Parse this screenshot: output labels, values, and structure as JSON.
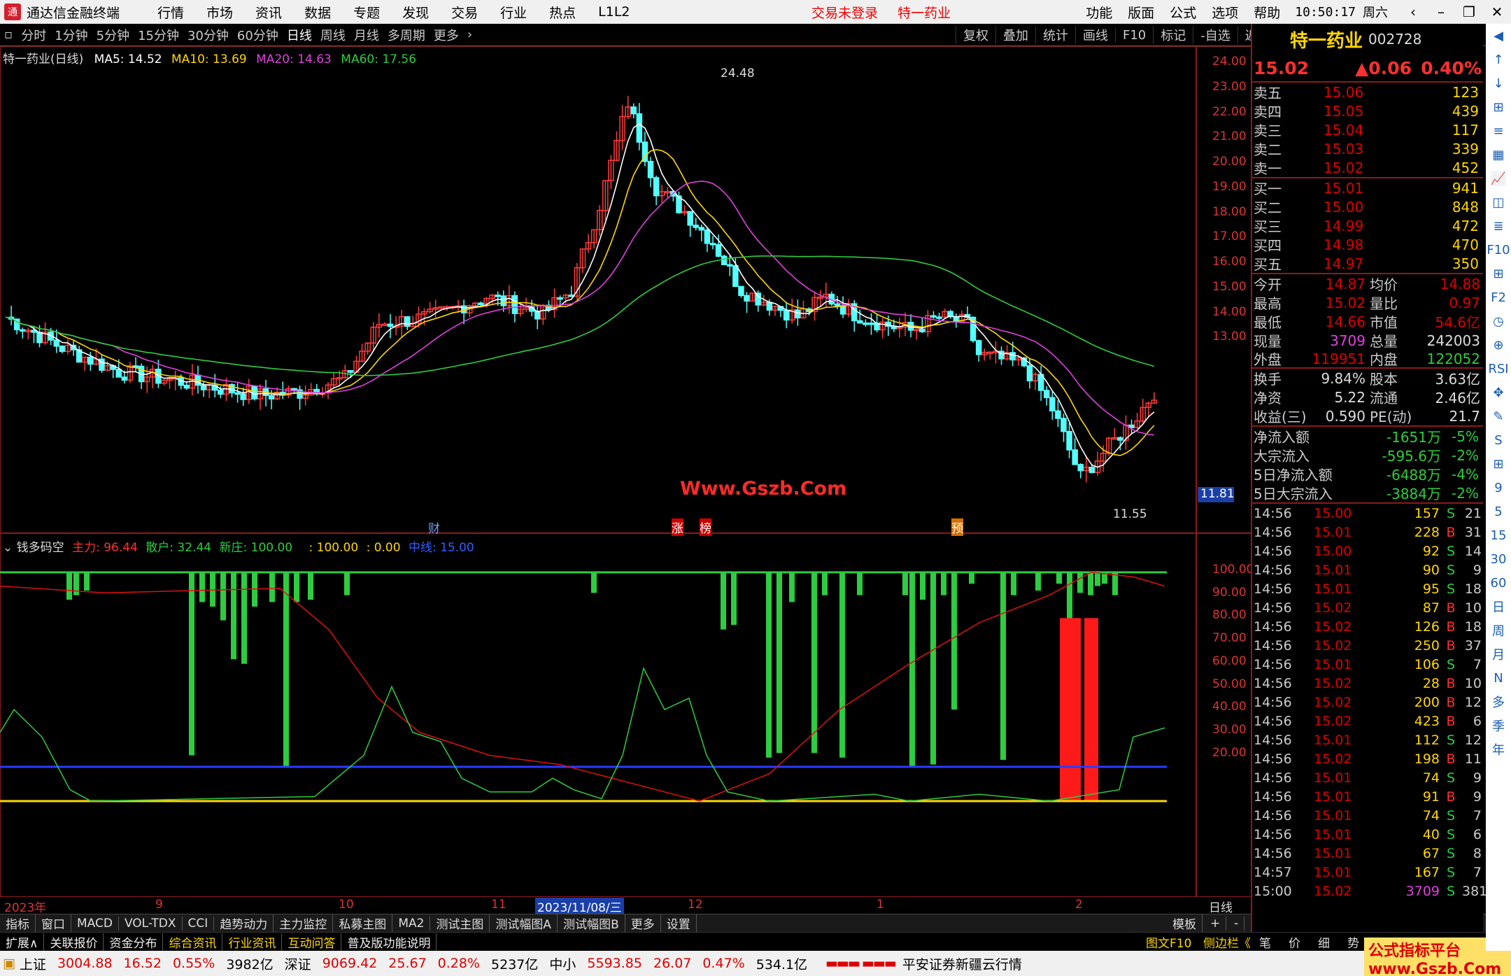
{
  "app": {
    "name": "通达信金融终端",
    "menu": [
      "行情",
      "市场",
      "资讯",
      "数据",
      "专题",
      "发现",
      "交易",
      "行业",
      "热点",
      "L1L2"
    ],
    "center": [
      "交易未登录",
      "特一药业"
    ],
    "right_menu": [
      "功能",
      "版面",
      "公式",
      "选项",
      "帮助"
    ],
    "clock": "10:50:17",
    "weekday": "周六"
  },
  "toolbar": {
    "tabs": [
      "分时",
      "1分钟",
      "5分钟",
      "15分钟",
      "30分钟",
      "60分钟",
      "日线",
      "周线",
      "月线",
      "多周期",
      "更多"
    ],
    "active_tab": "日线",
    "right": [
      "复权",
      "叠加",
      "统计",
      "画线",
      "F10",
      "标记",
      "-自选",
      "返回"
    ]
  },
  "chart_header": {
    "title": "特一药业(日线)",
    "ma5": "MA5: 14.52",
    "ma10": "MA10: 13.69",
    "ma20": "MA20: 14.63",
    "ma60": "MA60: 17.56"
  },
  "price_axis": [
    "24.00",
    "23.00",
    "22.00",
    "21.00",
    "20.00",
    "19.00",
    "18.00",
    "17.00",
    "16.00",
    "15.00",
    "14.00",
    "13.00"
  ],
  "current_price_tag": "11.81",
  "high_label": "24.48",
  "low_label": "11.55",
  "markers": [
    "财",
    "涨",
    "榜",
    "预"
  ],
  "indicator": {
    "name": "钱多码空",
    "zl": "主力: 96.44",
    "sh": "散户: 32.44",
    "xz": "新庄: 100.00",
    "v1": ": 100.00",
    "v2": ": 0.00",
    "zx": "中线: 15.00"
  },
  "ind_axis": [
    "100.00",
    "90.00",
    "80.00",
    "70.00",
    "60.00",
    "50.00",
    "40.00",
    "30.00",
    "20.00"
  ],
  "time_axis": [
    "2023年",
    "9",
    "10",
    "11",
    "2023/11/08/三",
    "12",
    "1",
    "2"
  ],
  "period_label": "日线",
  "watermark": "Www.Gszb.Com",
  "bottom_tabs": [
    "指标",
    "窗口",
    "MACD",
    "VOL-TDX",
    "CCI",
    "趋势动力",
    "主力监控",
    "私募主图",
    "MA2",
    "测试主图",
    "测试幅图A",
    "测试幅图B",
    "更多",
    "设置"
  ],
  "bottom_right": [
    "模板",
    "+",
    "-"
  ],
  "ext_tabs": [
    "扩展∧",
    "关联报价",
    "资金分布",
    "综合资讯",
    "行业资讯",
    "互动问答",
    "普及版功能说明"
  ],
  "ext_right": [
    "图文F10",
    "侧边栏《",
    "笔",
    "价",
    "细",
    "势"
  ],
  "stock": {
    "name": "特一药业",
    "code": "002728",
    "price": "15.02",
    "change": "▲0.06",
    "pct": "0.40%"
  },
  "asks": [
    [
      "卖五",
      "15.06",
      "123"
    ],
    [
      "卖四",
      "15.05",
      "439"
    ],
    [
      "卖三",
      "15.04",
      "117"
    ],
    [
      "卖二",
      "15.03",
      "339"
    ],
    [
      "卖一",
      "15.02",
      "452"
    ]
  ],
  "bids": [
    [
      "买一",
      "15.01",
      "941"
    ],
    [
      "买二",
      "15.00",
      "848"
    ],
    [
      "买三",
      "14.99",
      "472"
    ],
    [
      "买四",
      "14.98",
      "470"
    ],
    [
      "买五",
      "14.97",
      "350"
    ]
  ],
  "stats": [
    [
      "今开",
      "14.87",
      "均价",
      "14.88"
    ],
    [
      "最高",
      "15.02",
      "量比",
      "0.97"
    ],
    [
      "最低",
      "14.66",
      "市值",
      "54.6亿"
    ],
    [
      "现量",
      "3709",
      "总量",
      "242003"
    ],
    [
      "外盘",
      "119951",
      "内盘",
      "122052"
    ],
    [
      "换手",
      "9.84%",
      "股本",
      "3.63亿"
    ],
    [
      "净资",
      "5.22",
      "流通",
      "2.46亿"
    ],
    [
      "收益(三)",
      "0.590",
      "PE(动)",
      "21.7"
    ]
  ],
  "flows": [
    [
      "净流入额",
      "-1651万",
      "-5%"
    ],
    [
      "大宗流入",
      "-595.6万",
      "-2%"
    ],
    [
      "5日净流入额",
      "-6488万",
      "-4%"
    ],
    [
      "5日大宗流入",
      "-3884万",
      "-2%"
    ]
  ],
  "ticks": [
    [
      "14:56",
      "15.00",
      "157",
      "S",
      "21"
    ],
    [
      "14:56",
      "15.01",
      "228",
      "B",
      "31"
    ],
    [
      "14:56",
      "15.00",
      "92",
      "S",
      "14"
    ],
    [
      "14:56",
      "15.01",
      "90",
      "S",
      "9"
    ],
    [
      "14:56",
      "15.01",
      "95",
      "S",
      "18"
    ],
    [
      "14:56",
      "15.02",
      "87",
      "B",
      "10"
    ],
    [
      "14:56",
      "15.02",
      "126",
      "B",
      "18"
    ],
    [
      "14:56",
      "15.02",
      "250",
      "B",
      "37"
    ],
    [
      "14:56",
      "15.01",
      "106",
      "S",
      "7"
    ],
    [
      "14:56",
      "15.02",
      "28",
      "B",
      "10"
    ],
    [
      "14:56",
      "15.02",
      "200",
      "B",
      "12"
    ],
    [
      "14:56",
      "15.02",
      "423",
      "B",
      "6"
    ],
    [
      "14:56",
      "15.01",
      "112",
      "S",
      "12"
    ],
    [
      "14:56",
      "15.02",
      "198",
      "B",
      "11"
    ],
    [
      "14:56",
      "15.01",
      "74",
      "S",
      "9"
    ],
    [
      "14:56",
      "15.01",
      "91",
      "B",
      "9"
    ],
    [
      "14:56",
      "15.01",
      "74",
      "S",
      "7"
    ],
    [
      "14:56",
      "15.01",
      "40",
      "S",
      "6"
    ],
    [
      "14:56",
      "15.01",
      "67",
      "S",
      "8"
    ],
    [
      "14:57",
      "15.01",
      "167",
      "S",
      "7"
    ],
    [
      "15:00",
      "15.02",
      "3709",
      "S",
      "381"
    ]
  ],
  "status": {
    "sh": "上证",
    "sh_v": "3004.88",
    "sh_c": "16.52",
    "sh_p": "0.55%",
    "sh_a": "3982亿",
    "sz": "深证",
    "sz_v": "9069.42",
    "sz_c": "25.67",
    "sz_p": "0.28%",
    "sz_a": "5237亿",
    "zx": "中小",
    "zx_v": "5593.85",
    "zx_c": "26.07",
    "zx_p": "0.47%",
    "zx_a": "534.1亿",
    "broker": "平安证券新疆云行情"
  },
  "right_icons": [
    "◀",
    "↑",
    "↓",
    "⊞",
    "≡",
    "▦",
    "📈",
    "◫",
    "≣",
    "F10",
    "⊞",
    "F2",
    "◷",
    "⊕",
    "RSI",
    "✥",
    "✎",
    "S",
    "⊞",
    "9",
    "5",
    "15",
    "30",
    "60",
    "日",
    "周",
    "月",
    "N",
    "多",
    "季",
    "年"
  ],
  "footer_watermark": "公式指标平台 www.Gszb.Com"
}
